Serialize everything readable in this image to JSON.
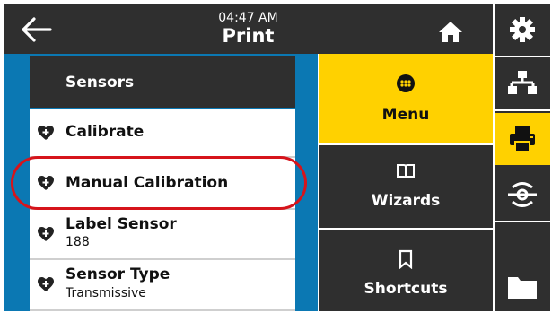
{
  "topbar": {
    "time": "04:47 AM",
    "title": "Print"
  },
  "left_menu": {
    "header": "Sensors",
    "items": [
      {
        "label": "Calibrate",
        "value": ""
      },
      {
        "label": "Manual Calibration",
        "value": ""
      },
      {
        "label": "Label Sensor",
        "value": "188"
      },
      {
        "label": "Sensor Type",
        "value": "Transmissive"
      }
    ]
  },
  "main_menu": [
    {
      "label": "Menu",
      "icon": "menu-icon"
    },
    {
      "label": "Wizards",
      "icon": "book-icon"
    },
    {
      "label": "Shortcuts",
      "icon": "bookmark-icon"
    }
  ],
  "sidebar": [
    {
      "icon": "settings-icon"
    },
    {
      "icon": "network-icon"
    },
    {
      "icon": "printer-icon"
    },
    {
      "icon": "wireless-icon"
    },
    {
      "icon": "folder-icon"
    }
  ],
  "colors": {
    "accent": "#ffd100",
    "dark": "#2f2f2f",
    "blue": "#0b78b3",
    "highlight": "#d6141b"
  }
}
